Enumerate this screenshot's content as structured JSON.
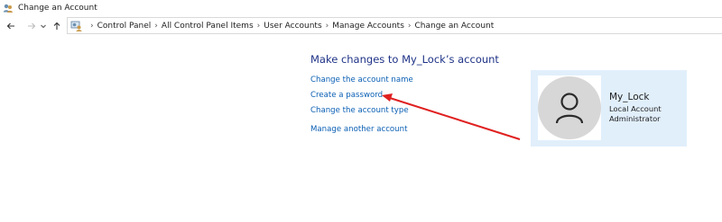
{
  "window": {
    "title": "Change an Account",
    "app_icon": "user-accounts-icon"
  },
  "navigation": {
    "back_icon": "back-arrow-icon",
    "forward_icon": "forward-arrow-icon",
    "dropdown_icon": "chevron-down-icon",
    "up_icon": "up-arrow-icon"
  },
  "address_bar": {
    "location_icon": "control-panel-icon",
    "breadcrumbs": [
      "Control Panel",
      "All Control Panel Items",
      "User Accounts",
      "Manage Accounts",
      "Change an Account"
    ]
  },
  "main": {
    "heading": "Make changes to My_Lock’s account",
    "links": {
      "change_name": "Change the account name",
      "create_password": "Create a password",
      "change_type": "Change the account type",
      "manage_another": "Manage another account"
    }
  },
  "account": {
    "avatar_icon": "user-avatar-icon",
    "name": "My_Lock",
    "type": "Local Account",
    "role": "Administrator"
  },
  "annotation": {
    "type": "arrow",
    "color": "#e02020",
    "points_to": "Create a password"
  },
  "colors": {
    "heading": "#1e3287",
    "link": "#0a5fb4",
    "panel_background": "#e1effb",
    "avatar_background": "#d7d7d7"
  }
}
